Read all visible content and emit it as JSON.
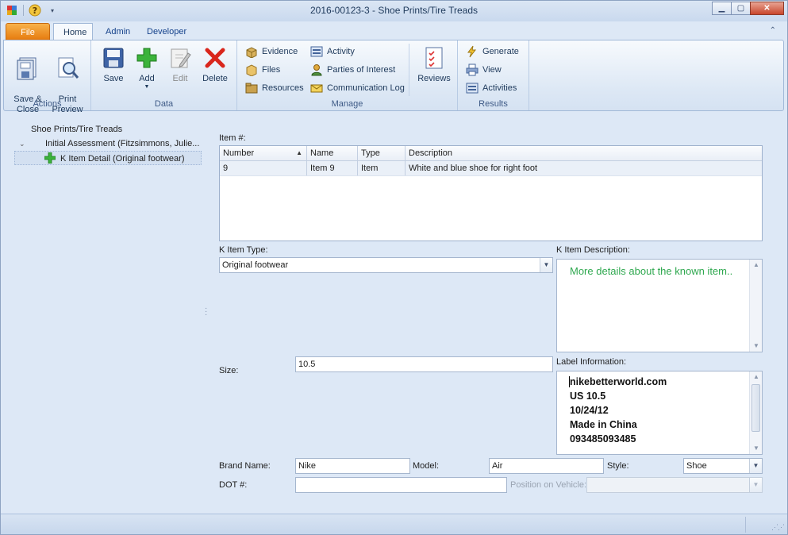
{
  "window": {
    "title": "2016-00123-3 - Shoe Prints/Tire Treads"
  },
  "ribbon_tabs": [
    "File",
    "Home",
    "Admin",
    "Developer"
  ],
  "ribbon": {
    "actions": {
      "label": "Actions",
      "save_close": "Save &\nClose",
      "print_preview": "Print\nPreview"
    },
    "data": {
      "label": "Data",
      "save": "Save",
      "add": "Add",
      "edit": "Edit",
      "delete": "Delete"
    },
    "manage": {
      "label": "Manage",
      "evidence": "Evidence",
      "files": "Files",
      "resources": "Resources",
      "activity": "Activity",
      "parties": "Parties of Interest",
      "commlog": "Communication Log",
      "reviews": "Reviews"
    },
    "results": {
      "label": "Results",
      "generate": "Generate",
      "view": "View",
      "activities": "Activities"
    }
  },
  "tree": {
    "root": "Shoe Prints/Tire Treads",
    "child": "Initial Assessment (Fitzsimmons, Julie...",
    "grandchild": "K Item Detail (Original footwear)"
  },
  "form": {
    "item_label": "Item #:",
    "grid": {
      "headers": [
        "Number",
        "Name",
        "Type",
        "Description"
      ],
      "rows": [
        {
          "number": "9",
          "name": "Item 9",
          "type": "Item",
          "description": "White and blue shoe for right foot"
        }
      ]
    },
    "k_item_type_label": "K Item Type:",
    "k_item_type_value": "Original footwear",
    "k_item_desc_label": "K Item Description:",
    "k_item_desc_placeholder": "More details about the known item..",
    "size_label": "Size:",
    "size_value": "10.5",
    "label_info_label": "Label Information:",
    "label_info_lines": [
      "nikebetterworld.com",
      "US 10.5",
      "10/24/12",
      "Made in China",
      "093485093485"
    ],
    "brand_label": "Brand Name:",
    "brand_value": "Nike",
    "model_label": "Model:",
    "model_value": "Air",
    "style_label": "Style:",
    "style_value": "Shoe",
    "dot_label": "DOT #:",
    "dot_value": "",
    "position_label": "Position on Vehicle:",
    "position_value": ""
  }
}
